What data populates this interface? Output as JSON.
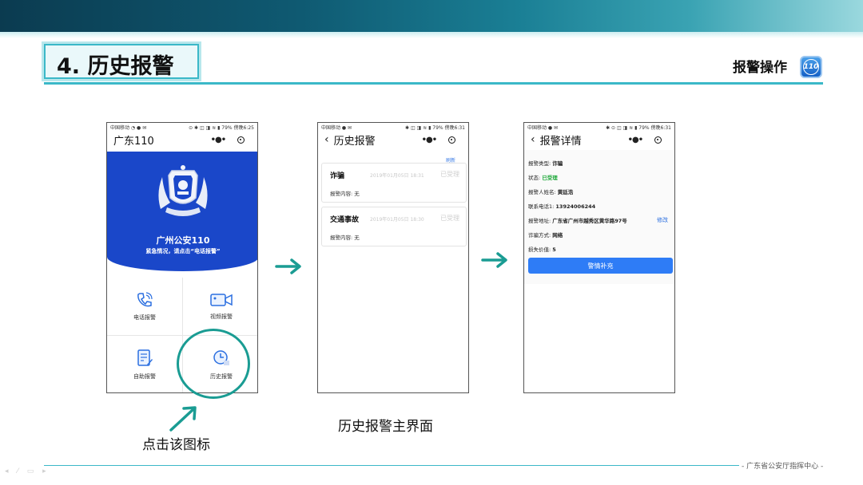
{
  "slide": {
    "title": "4. 历史报警",
    "section_label": "报警操作",
    "logo_text": "110",
    "caption_click": "点击该图标",
    "caption_main": "历史报警主界面",
    "footer": "- 广东省公安厅指挥中心 -",
    "accent_color": "#3bb8c8",
    "arrow_color": "#1a9c93"
  },
  "phone1": {
    "status_left": "中国移动 ◔ ● ✉",
    "status_right": "⊙ ✱ ◫ ◨ ≋ ▮ 79% 傍晚6:25",
    "nav_title": "广东110",
    "hero_title": "广州公安110",
    "hero_subtitle": "紧急情况，请点击“电话报警”",
    "hero_color": "#1a47c9",
    "grid": [
      {
        "label": "电话报警",
        "icon": "phone-call-icon"
      },
      {
        "label": "视频报警",
        "icon": "video-camera-icon"
      },
      {
        "label": "自助报警",
        "icon": "self-report-form-icon"
      },
      {
        "label": "历史报警",
        "icon": "history-clock-icon"
      }
    ]
  },
  "phone2": {
    "status_left": "中国移动 ● ✉",
    "status_right": "✱ ◫ ◨ ≋ ▮ 79% 傍晚6:31",
    "nav_title": "历史报警",
    "refresh": "刷新",
    "records": [
      {
        "type": "诈骗",
        "time": "2019年01月05日 18:31",
        "status": "已受理",
        "content": "报警内容: 无"
      },
      {
        "type": "交通事故",
        "time": "2019年01月05日 18:30",
        "status": "已受理",
        "content": "报警内容: 无"
      }
    ]
  },
  "phone3": {
    "status_left": "中国移动 ● ✉",
    "status_right": "✱ ⊙ ◫ ◨ ≋ ▮ 79% 傍晚6:31",
    "nav_title": "报警详情",
    "fields": [
      {
        "label": "报警类型: ",
        "value": "诈骗"
      },
      {
        "label": "状态: ",
        "value": "已受理"
      },
      {
        "label": "报警人姓名: ",
        "value": "黄廷浩"
      },
      {
        "label": "联系电话1: ",
        "value": "13924006244"
      },
      {
        "label": "报警地址: ",
        "value": "广东省广州市越秀区黄华路97号"
      },
      {
        "label": "诈骗方式: ",
        "value": "网络"
      },
      {
        "label": "损失价值: ",
        "value": "5"
      }
    ],
    "edit_link": "修改",
    "supplement_button": "警情补充",
    "button_color": "#2e7cf6"
  }
}
